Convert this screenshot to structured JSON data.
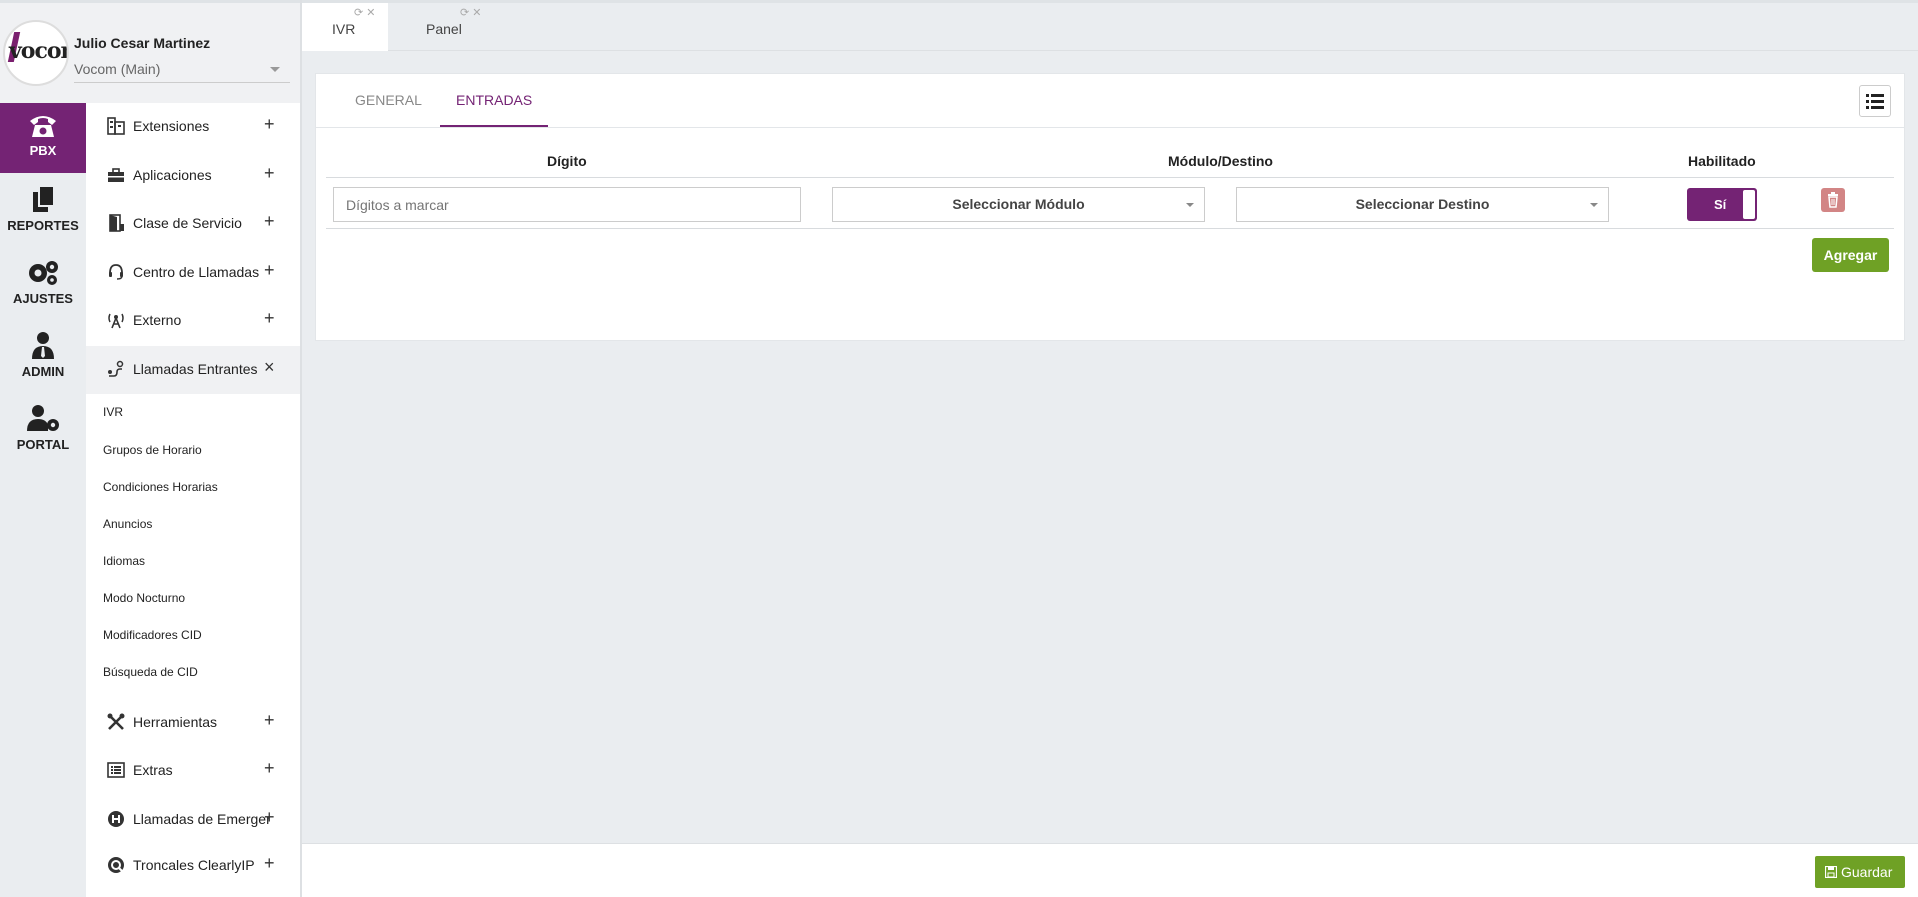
{
  "user": {
    "name": "Julio Cesar Martinez",
    "tenant": "Vocom (Main)",
    "logo_text": "vocom"
  },
  "rail": [
    {
      "label": "PBX",
      "icon": "phone-icon"
    },
    {
      "label": "REPORTES",
      "icon": "documents-icon"
    },
    {
      "label": "AJUSTES",
      "icon": "gears-icon"
    },
    {
      "label": "ADMIN",
      "icon": "user-tie-icon"
    },
    {
      "label": "PORTAL",
      "icon": "user-gear-icon"
    }
  ],
  "menu": [
    {
      "label": "Extensiones",
      "toggle": "+"
    },
    {
      "label": "Aplicaciones",
      "toggle": "+"
    },
    {
      "label": "Clase de Servicio",
      "toggle": "+"
    },
    {
      "label": "Centro de Llamadas",
      "toggle": "+"
    },
    {
      "label": "Externo",
      "toggle": "+"
    },
    {
      "label": "Llamadas Entrantes",
      "toggle": "×"
    },
    {
      "label": "Herramientas",
      "toggle": "+"
    },
    {
      "label": "Extras",
      "toggle": "+"
    },
    {
      "label": "Llamadas de Emergencia",
      "toggle": "+"
    },
    {
      "label": "Troncales ClearlyIP",
      "toggle": "+"
    }
  ],
  "submenu": [
    "IVR",
    "Grupos de Horario",
    "Condiciones Horarias",
    "Anuncios",
    "Idiomas",
    "Modo Nocturno",
    "Modificadores CID",
    "Búsqueda de CID"
  ],
  "page_tabs": [
    {
      "label": "IVR"
    },
    {
      "label": "Panel"
    }
  ],
  "card_tabs": {
    "general": "GENERAL",
    "entradas": "ENTRADAS"
  },
  "table": {
    "headers": {
      "digit": "Dígito",
      "module": "Módulo/Destino",
      "enabled": "Habilitado"
    },
    "row": {
      "digit_placeholder": "Dígitos a marcar",
      "module_select": "Seleccionar Módulo",
      "destination_select": "Seleccionar Destino",
      "enabled_value": "Sí"
    }
  },
  "actions": {
    "add": "Agregar",
    "save": "Guardar"
  },
  "colors": {
    "accent": "#742374",
    "success": "#6fa125",
    "danger": "#d28585"
  }
}
